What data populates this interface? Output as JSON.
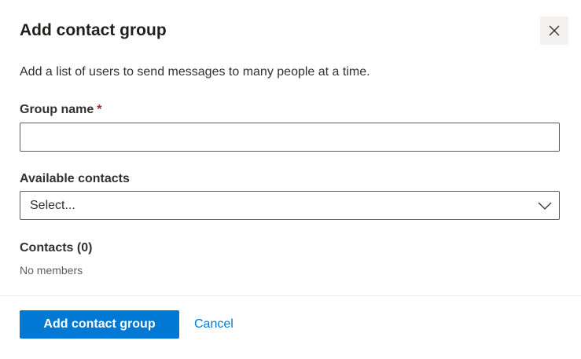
{
  "dialog": {
    "title": "Add contact group",
    "description": "Add a list of users to send messages to many people at a time.",
    "close_icon": "close-icon"
  },
  "form": {
    "group_name_label": "Group name",
    "required_marker": "*",
    "group_name_value": "",
    "available_contacts_label": "Available contacts",
    "available_contacts_selected": "Select...",
    "dropdown_icon": "chevron-down-icon",
    "contacts_label": "Contacts (0)",
    "contacts_empty": "No members"
  },
  "footer": {
    "primary_label": "Add contact group",
    "cancel_label": "Cancel"
  },
  "colors": {
    "accent": "#0078d4",
    "required": "#a4262c",
    "close_button_bg": "#f3f2f1"
  }
}
